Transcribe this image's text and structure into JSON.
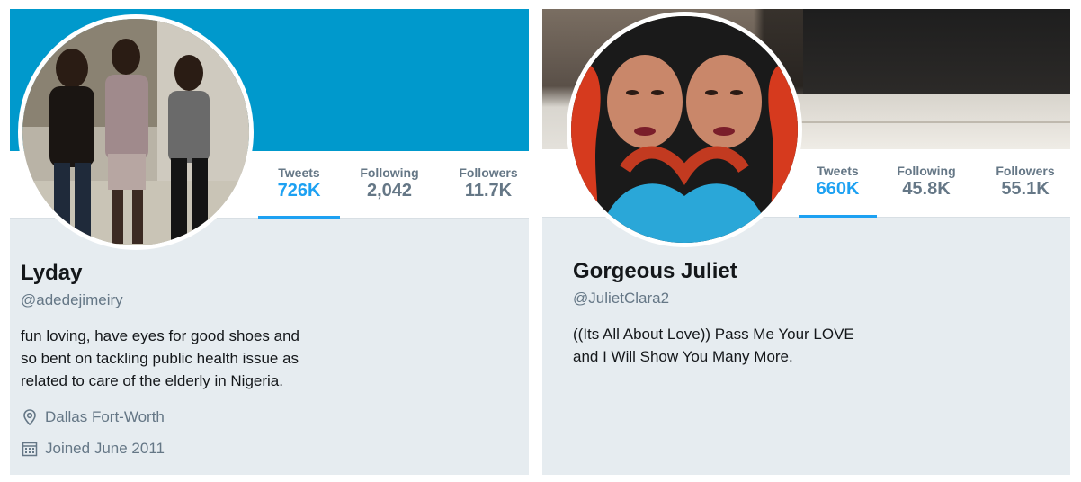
{
  "profiles": [
    {
      "banner_color": "#0099cc",
      "stats": [
        {
          "label": "Tweets",
          "value": "726K"
        },
        {
          "label": "Following",
          "value": "2,042"
        },
        {
          "label": "Followers",
          "value": "11.7K"
        }
      ],
      "name": "Lyday",
      "handle": "@adedejimeiry",
      "bio_lines": [
        "fun loving, have eyes for good shoes and",
        "so bent on tackling public health issue as",
        "related to care of the elderly in Nigeria."
      ],
      "location": "Dallas Fort-Worth",
      "joined": "Joined June 2011",
      "location_icon": "map-pin-icon",
      "joined_icon": "calendar-icon"
    },
    {
      "stats": [
        {
          "label": "Tweets",
          "value": "660K"
        },
        {
          "label": "Following",
          "value": "45.8K"
        },
        {
          "label": "Followers",
          "value": "55.1K"
        }
      ],
      "name": "Gorgeous Juliet",
      "handle": "@JulietClara2",
      "bio_lines": [
        "((Its All About Love)) Pass Me Your LOVE",
        "and I Will Show You Many More."
      ]
    }
  ],
  "accent_color": "#1da1f2"
}
